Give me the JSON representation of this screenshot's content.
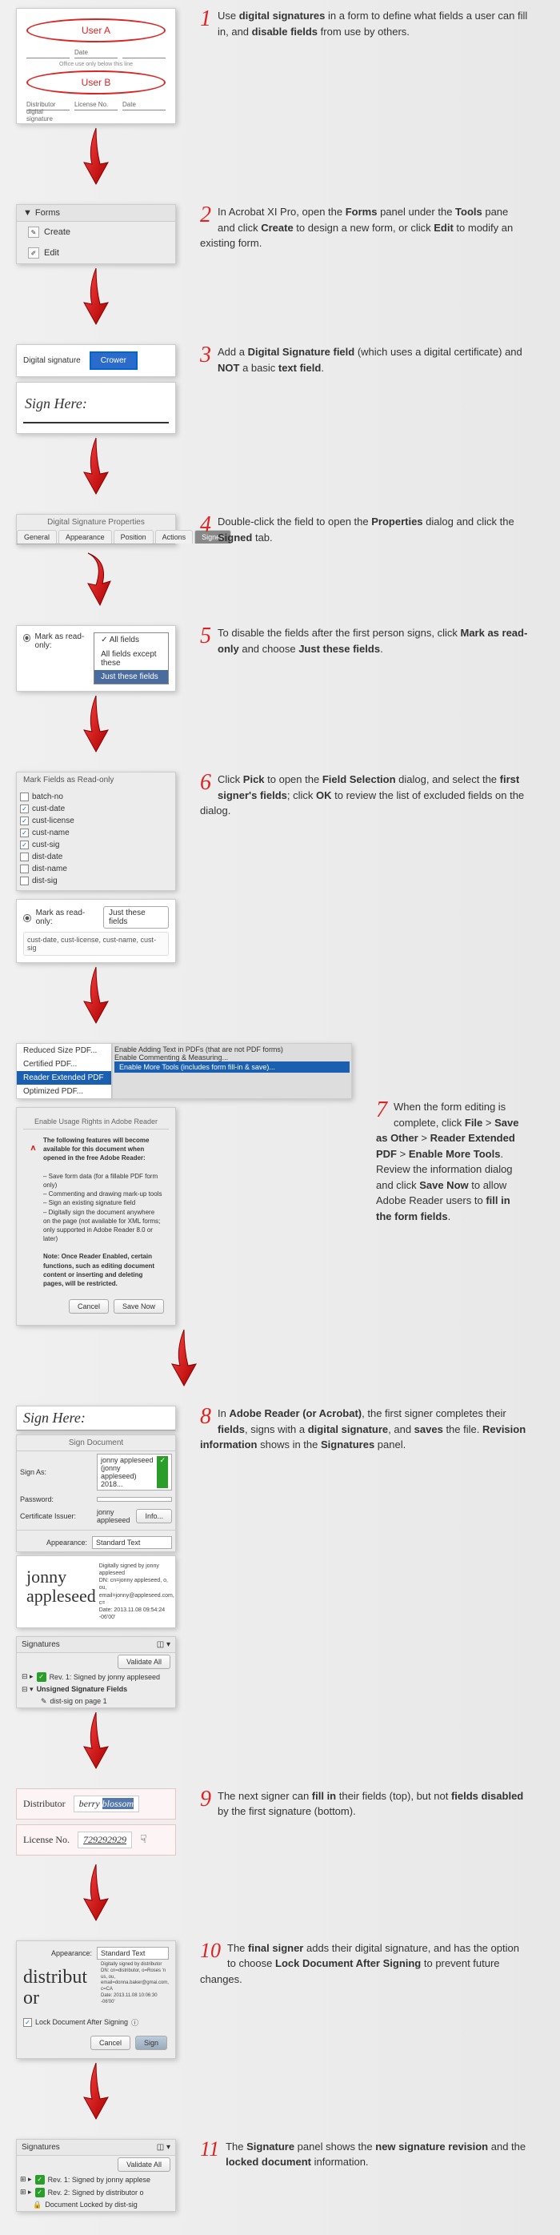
{
  "steps": [
    {
      "n": "1",
      "text_pre": "Use ",
      "b1": "digital signatures",
      "text_mid": " in a form to define what fields a user can fill in, and ",
      "b2": "disable fields",
      "text_post": " from use by others."
    },
    {
      "n": "2",
      "text": "In Acrobat XI Pro, open the <b>Forms</b> panel under the <b>Tools</b> pane and click <b>Create</b> to design a new form, or click <b>Edit</b> to modify an existing form."
    },
    {
      "n": "3",
      "text": "Add a <b>Digital Signature field</b> (which uses a digital certificate) and <b>NOT</b> a basic <b>text field</b>."
    },
    {
      "n": "4",
      "text": "Double-click the field to open the <b>Properties</b> dialog and click the <b>Signed</b> tab."
    },
    {
      "n": "5",
      "text": "To disable the fields after the first person signs, click <b>Mark as read-only</b> and choose <b>Just these fields</b>."
    },
    {
      "n": "6",
      "text": "Click <b>Pick</b> to open the <b>Field Selection</b> dialog, and select the <b>first signer's fields</b>; click <b>OK</b> to review the list of excluded fields on the dialog."
    },
    {
      "n": "7",
      "text": "When the form editing is complete, click <b>File</b> > <b>Save as Other</b> > <b>Reader Extended PDF</b> > <b>Enable More Tools</b>. Review the information dialog and click <b>Save Now</b> to allow Adobe Reader users to <b>fill in the form fields</b>."
    },
    {
      "n": "8",
      "text": "In <b>Adobe Reader (or Acrobat)</b>, the first signer completes their <b>fields</b>, signs with a <b>digital signature</b>, and <b>saves</b> the file. <b>Revision information</b> shows in the <b>Signatures</b> panel."
    },
    {
      "n": "9",
      "text": "The next signer can <b>fill in</b> their fields (top), but not <b>fields disabled</b> by the first signature (bottom)."
    },
    {
      "n": "10",
      "text": "The <b>final signer</b> adds their digital signature, and has the option to choose <b>Lock Document After Signing</b> to prevent future changes."
    },
    {
      "n": "11",
      "text": "The <b>Signature</b> panel shows the <b>new signature revision</b> and the <b>locked document</b> information."
    }
  ],
  "shot1": {
    "userA": "User A",
    "userB": "User B",
    "office_text": "Office use only below this line"
  },
  "shot2": {
    "panel_title": "Forms",
    "create": "Create",
    "edit": "Edit"
  },
  "shot3": {
    "label": "Digital signature",
    "field_text": "Crower",
    "sign_here": "Sign Here:"
  },
  "shot4": {
    "title": "Digital Signature Properties",
    "tabs": [
      "General",
      "Appearance",
      "Position",
      "Actions",
      "Signed"
    ]
  },
  "shot5": {
    "label": "Mark as read-only:",
    "opts": [
      "All fields",
      "All fields except these",
      "Just these fields"
    ]
  },
  "shot6": {
    "title": "Mark Fields as Read-only",
    "fields": [
      {
        "name": "batch-no",
        "checked": false
      },
      {
        "name": "cust-date",
        "checked": true
      },
      {
        "name": "cust-license",
        "checked": true
      },
      {
        "name": "cust-name",
        "checked": true
      },
      {
        "name": "cust-sig",
        "checked": true
      },
      {
        "name": "dist-date",
        "checked": false
      },
      {
        "name": "dist-name",
        "checked": false
      },
      {
        "name": "dist-sig",
        "checked": false
      }
    ],
    "dropdown_label": "Mark as read-only:",
    "dropdown_val": "Just these fields",
    "selected_fields": "cust-date, cust-license, cust-name, cust-sig"
  },
  "shot7": {
    "menu": [
      "Reduced Size PDF...",
      "Certified PDF...",
      "Reader Extended PDF",
      "Optimized PDF..."
    ],
    "submenu": [
      "Enable Adding Text in PDFs (that are not PDF forms)",
      "Enable Commenting & Measuring...",
      "Enable More Tools (includes form fill-in & save)..."
    ],
    "rights_title": "Enable Usage Rights in Adobe Reader",
    "rights_intro": "The following features will become available for this document when opened in the free Adobe Reader:",
    "rights_items": [
      "– Save form data (for a fillable PDF form only)",
      "– Commenting and drawing mark-up tools",
      "– Sign an existing signature field",
      "– Digitally sign the document anywhere on the page (not available for XML forms; only supported in Adobe Reader 8.0 or later)"
    ],
    "rights_note": "Note: Once Reader Enabled, certain functions, such as editing document content or inserting and deleting pages, will be restricted.",
    "cancel": "Cancel",
    "save_now": "Save Now"
  },
  "shot8": {
    "sign_here": "Sign Here:",
    "dialog_title": "Sign Document",
    "sign_as_lbl": "Sign As:",
    "sign_as_val": "jonny appleseed (jonny appleseed) 2018...",
    "password_lbl": "Password:",
    "cert_issuer_lbl": "Certificate Issuer:",
    "cert_issuer_val": "jonny appleseed",
    "info_btn": "Info...",
    "appearance_lbl": "Appearance:",
    "appearance_val": "Standard Text",
    "sig_name": "jonny appleseed",
    "sig_details": "Digitally signed by jonny appleseed\nDN: cn=jonny appleseed, o, ou,\nemail=jonny@appleseed.com,\nc=\nDate: 2013.11.08 09:54:24\n-06'00'",
    "panel_title": "Signatures",
    "validate_all": "Validate All",
    "rev1": "Rev. 1: Signed by jonny appleseed",
    "unsigned": "Unsigned Signature Fields",
    "page1": "dist-sig on page 1"
  },
  "shot9": {
    "dist_lbl": "Distributor",
    "dist_val_pre": "berry ",
    "dist_val_hilite": "blossom",
    "lic_lbl": "License No.",
    "lic_val": "729292929"
  },
  "shot10": {
    "appearance_lbl": "Appearance:",
    "appearance_val": "Standard Text",
    "sig_name": "distribut or",
    "sig_details": "Digitally signed by distributor\nDN: cn=distributor, o=Roses 'n us, ou,\nemail=donna.baker@gmai.com, c=CA\nDate: 2013.11.08 10:06:30 -06'00'",
    "lock_lbl": "Lock Document After Signing",
    "cancel": "Cancel",
    "sign": "Sign"
  },
  "shot11": {
    "panel_title": "Signatures",
    "validate": "Validate All",
    "rev1": "Rev. 1: Signed by jonny applese",
    "rev2": "Rev. 2: Signed by distributor o",
    "locked": "Document Locked by dist-sig"
  }
}
